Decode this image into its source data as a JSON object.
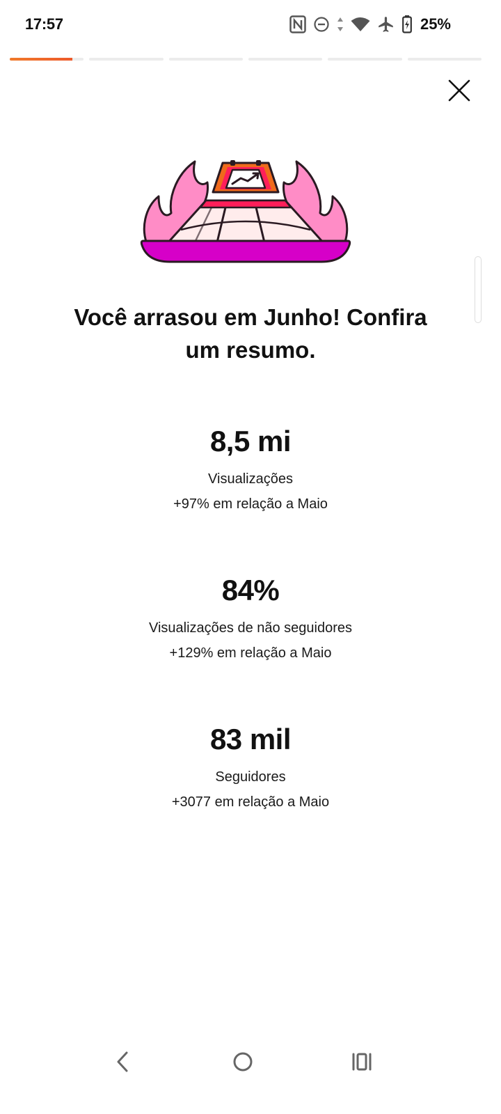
{
  "status_bar": {
    "time": "17:57",
    "battery_percent": "25%",
    "icons": [
      "nfc-icon",
      "do-not-disturb-icon",
      "data-arrows-icon",
      "wifi-icon",
      "airplane-icon",
      "battery-charging-icon"
    ]
  },
  "story_progress": {
    "segments": 6,
    "active_segment": 1,
    "active_fill": 0.85,
    "accent_color": "#F07A2A"
  },
  "close_icon": "close-icon",
  "illustration_icon": "trophy-fire-icon",
  "colors": {
    "flame": "#FF8CC6",
    "base": "#D600C8",
    "accent_red": "#FF1F5A",
    "accent_orange": "#F06A1C",
    "cream": "#FFECEC"
  },
  "headline": {
    "line1": "Você arrasou em Junho! Confira",
    "line2": "um resumo."
  },
  "stats": [
    {
      "value": "8,5 mi",
      "label": "Visualizações",
      "delta": "+97% em relação a Maio"
    },
    {
      "value": "84%",
      "label": "Visualizações de não seguidores",
      "delta": "+129% em relação a Maio"
    },
    {
      "value": "83 mil",
      "label": "Seguidores",
      "delta": "+3077 em relação a Maio"
    }
  ],
  "nav_bar": {
    "icons": [
      "back-icon",
      "home-icon",
      "recents-icon"
    ]
  }
}
